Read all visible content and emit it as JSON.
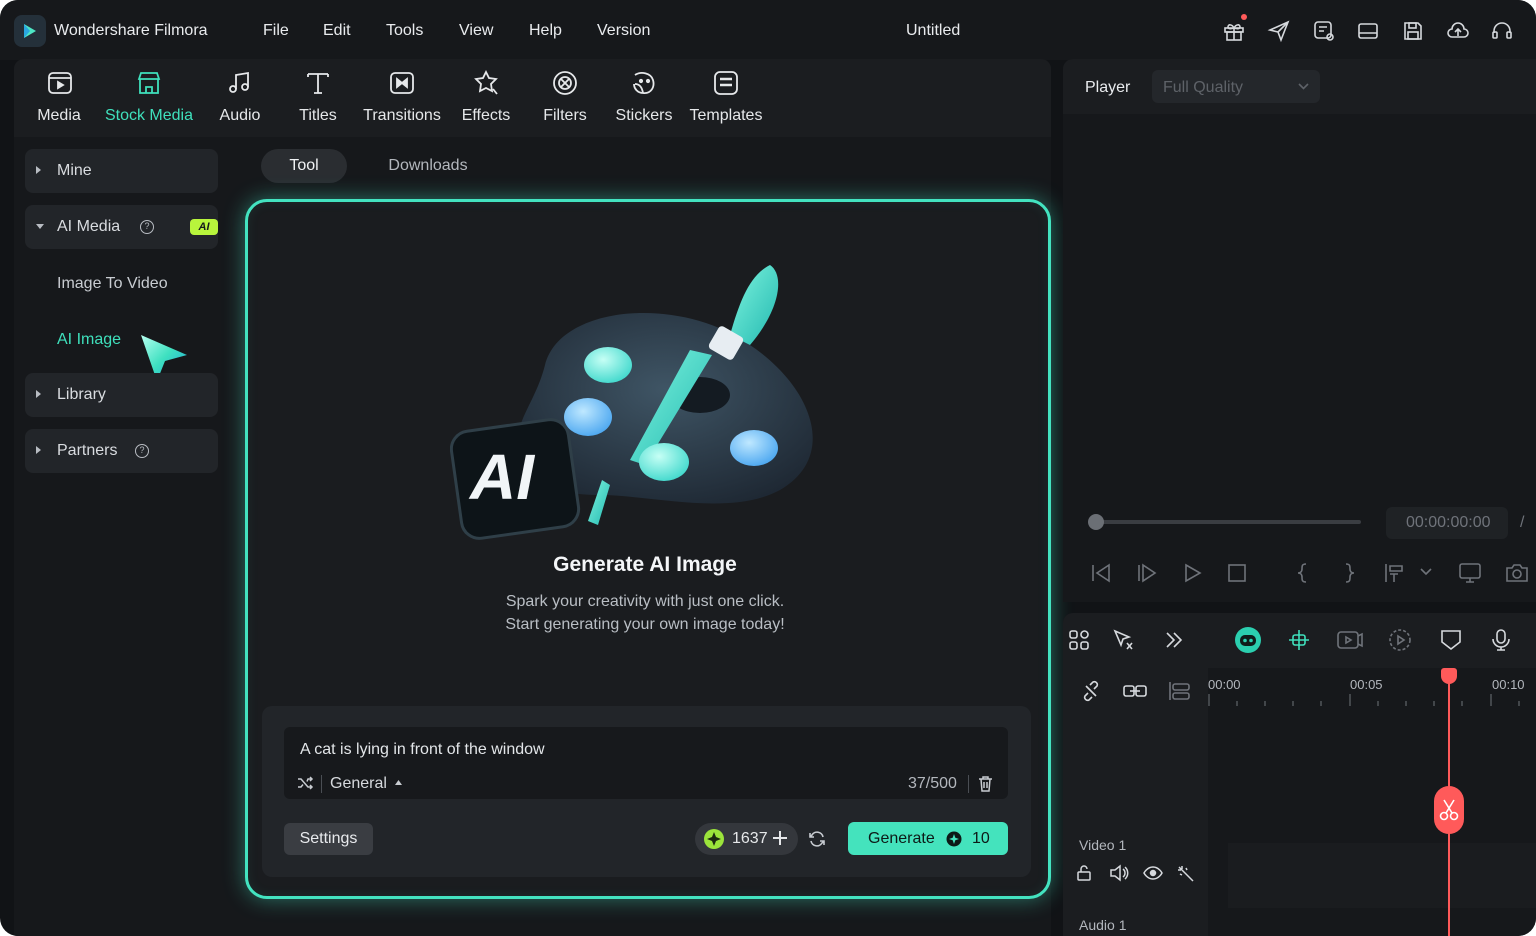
{
  "titlebar": {
    "app_name": "Wondershare Filmora",
    "menus": [
      "File",
      "Edit",
      "Tools",
      "View",
      "Help",
      "Version"
    ],
    "doc_title": "Untitled",
    "icons": [
      "gift-icon",
      "send-icon",
      "feedback-icon",
      "layout-icon",
      "save-icon",
      "cloud-upload-icon",
      "support-headset-icon"
    ]
  },
  "toolbar": {
    "items": [
      {
        "label": "Media",
        "icon": "media-icon"
      },
      {
        "label": "Stock Media",
        "icon": "stock-media-icon",
        "active": true
      },
      {
        "label": "Audio",
        "icon": "audio-icon"
      },
      {
        "label": "Titles",
        "icon": "titles-icon"
      },
      {
        "label": "Transitions",
        "icon": "transitions-icon"
      },
      {
        "label": "Effects",
        "icon": "effects-icon"
      },
      {
        "label": "Filters",
        "icon": "filters-icon"
      },
      {
        "label": "Stickers",
        "icon": "stickers-icon"
      },
      {
        "label": "Templates",
        "icon": "templates-icon"
      }
    ]
  },
  "sidebar": {
    "mine": "Mine",
    "ai_media": "AI Media",
    "ai_badge": "AI",
    "image_to_video": "Image To Video",
    "ai_image": "AI Image",
    "library": "Library",
    "partners": "Partners"
  },
  "tabs": {
    "tool": "Tool",
    "downloads": "Downloads"
  },
  "generator": {
    "hero_badge": "AI",
    "title": "Generate AI Image",
    "subtitle_line1": "Spark your creativity with just one click.",
    "subtitle_line2": "Start generating your own image today!",
    "prompt": "A cat is lying in front of the window",
    "style": "General",
    "char_count": "37/500",
    "settings_label": "Settings",
    "credits": "1637",
    "generate_label": "Generate",
    "generate_cost": "10"
  },
  "player": {
    "label": "Player",
    "quality": "Full Quality",
    "timecode": "00:00:00:00",
    "separator": "/"
  },
  "timeline": {
    "ruler": [
      "00:00",
      "00:05",
      "00:10"
    ],
    "tracks": [
      "Video 1",
      "Audio 1"
    ]
  },
  "colors": {
    "accent": "#44e3bd",
    "playhead": "#ff5a5a",
    "ai_badge": "#b8f53c"
  }
}
